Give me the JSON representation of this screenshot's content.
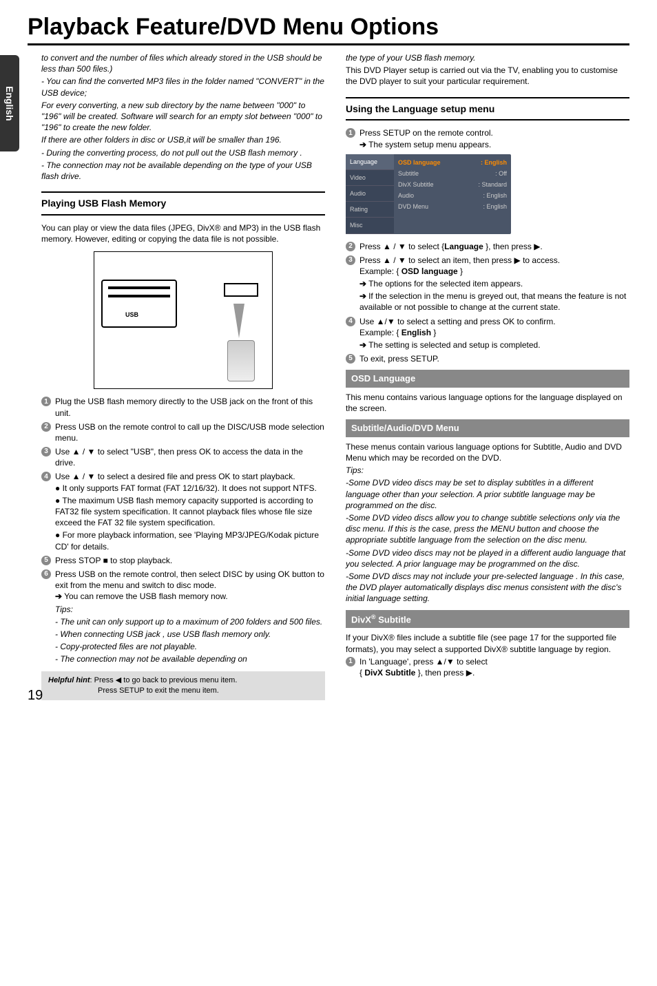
{
  "title": "Playback Feature/DVD Menu Options",
  "side_tab": "English",
  "page_number": "19",
  "left": {
    "intro": [
      "to convert and the number of files which already stored in the USB should be less than 500 files.)",
      "- You can find the converted MP3 files  in the folder named \"CONVERT\" in the USB device;",
      "For every converting, a new sub directory by the name between \"000\" to \"196\" will be created. Software will search for an empty slot between \"000\" to \"196\" to create the new folder.",
      "If there are other folders in disc or USB,it will be smaller than 196.",
      "- During the converting process, do not pull out the USB flash memory .",
      "- The connection may not be available depending on the type of your USB flash drive."
    ],
    "sec1_title": "Playing USB Flash Memory",
    "sec1_intro": "You can play or view the data files (JPEG, DivX® and MP3) in the USB flash memory. However, editing or copying the data file is not possible.",
    "usb_label": "USB",
    "steps": {
      "s1": "Plug the USB flash memory directly to the USB jack on the front of this unit.",
      "s2": "Press USB on the remote control to call up the DISC/USB mode selection menu.",
      "s3": "Use ▲ / ▼ to select \"USB\", then press OK to access the data in the drive.",
      "s4": "Use ▲ / ▼ to select a desired file and press OK to start playback.",
      "s4_b1": "● It only supports FAT format (FAT 12/16/32). It does not support NTFS.",
      "s4_b2": "● The maximum USB flash memory capacity supported is according to FAT32 file system specification. It cannot playback files whose file size exceed the FAT 32 file system specification.",
      "s4_b3": "● For more playback information, see 'Playing MP3/JPEG/Kodak picture CD' for details.",
      "s5": "Press STOP ■ to stop playback.",
      "s6": "Press USB on the remote control, then select DISC by using OK button to exit from the menu and switch to disc mode.",
      "s6_a": "You can remove the USB flash memory now.",
      "tips_label": "Tips:",
      "t1": "- The unit can only support up to a maximum of 200 folders and 500 files.",
      "t2": "- When connecting USB jack , use USB flash memory only.",
      "t3": "- Copy-protected files are not playable.",
      "t4": "- The connection may not be available depending on"
    },
    "hint_label": "Helpful hint",
    "hint1": ":  Press ◀ to go back to previous menu item.",
    "hint2": "Press SETUP to exit the menu item."
  },
  "right": {
    "top_italic": "the type of your USB flash memory.",
    "top_p": "This DVD Player setup is carried out via the TV, enabling you to customise the DVD player to suit your particular requirement.",
    "sec_title": "Using the Language  setup menu",
    "r_s1": "Press SETUP on the remote control.",
    "r_s1_a": "The system setup menu appears.",
    "menu_left": [
      "Language",
      "Video",
      "Audio",
      "Rating",
      "Misc"
    ],
    "menu_rows": [
      {
        "k": "OSD language",
        "v": ": English",
        "sel": true
      },
      {
        "k": "Subtitle",
        "v": ": Off"
      },
      {
        "k": "DivX Subtitle",
        "v": ": Standard"
      },
      {
        "k": "Audio",
        "v": ": English"
      },
      {
        "k": "DVD Menu",
        "v": ": English"
      }
    ],
    "r_s2_a": "Press ▲ / ▼ to select {",
    "r_s2_bold": "Language",
    "r_s2_b": " }, then press ▶.",
    "r_s3": "Press ▲ / ▼ to select an item, then press ▶ to access.",
    "ex1_a": "Example: { ",
    "ex1_bold": "OSD language",
    "ex1_b": " }",
    "r_s3_a1": "The options for the selected item appears.",
    "r_s3_a2": "If the selection in the menu is greyed out, that means the feature is not available or not possible to change at the current state.",
    "r_s4": "Use ▲/▼ to select a setting and press OK to confirm.",
    "ex2_a": "Example: { ",
    "ex2_bold": "English",
    "ex2_b": " }",
    "r_s4_a": "The setting is selected and setup is completed.",
    "r_s5": "To exit, press SETUP.",
    "osd_hdr": "OSD Language",
    "osd_p": "This menu contains various language options for the language displayed on the screen.",
    "sub_hdr": "Subtitle/Audio/DVD Menu",
    "sub_p": "These menus contain various language options for Subtitle, Audio and DVD Menu which may be recorded on the DVD.",
    "tips": "Tips:",
    "tip_p1": "-Some DVD video discs may be set to display subtitles in a different language other than your selection. A prior subtitle language may be programmed on the disc.",
    "tip_p2": "-Some DVD video discs allow you to change subtitle selections only via the disc menu. If this is the case, press the MENU button and choose the appropriate subtitle language  from the selection on the disc menu.",
    "tip_p3": "-Some DVD video discs may not be played in a different audio language that you selected. A prior language may be programmed on the disc.",
    "tip_p4": "-Some DVD discs may not include your pre-selected language . In this case, the DVD player automatically displays disc menus consistent with the disc's initial language setting.",
    "divx_hdr_a": "DivX",
    "divx_hdr_b": " Subtitle",
    "divx_p": "If your DivX® files include a subtitle file (see page 17 for the supported file formats), you may select a supported DivX® subtitle language by region.",
    "divx_s1": " In 'Language', press ▲/▼ to select",
    "divx_s1b_a": "{ ",
    "divx_s1b_bold": "DivX Subtitle",
    "divx_s1b_b": " }, then press ▶."
  }
}
